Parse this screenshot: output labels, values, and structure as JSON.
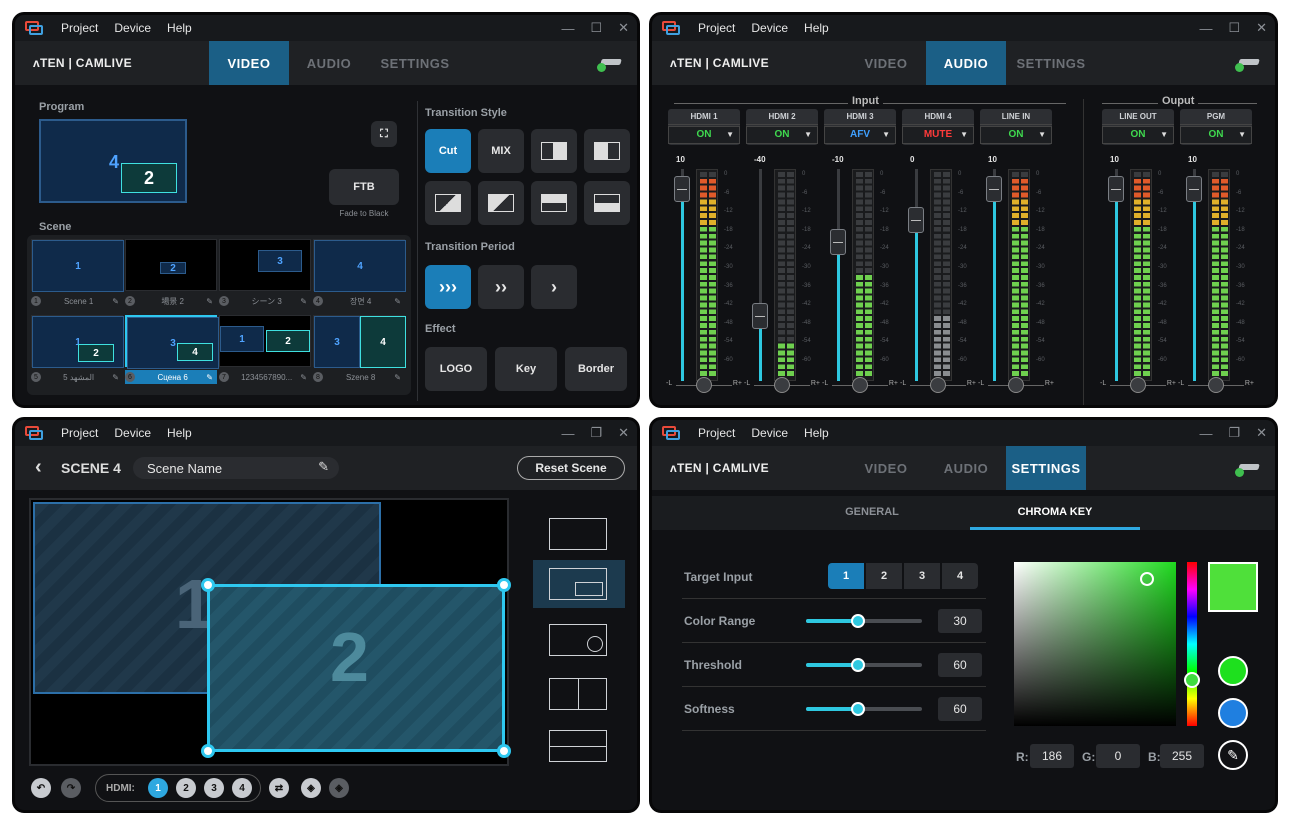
{
  "common": {
    "menu": [
      "Project",
      "Device",
      "Help"
    ],
    "brand": "ʌTEN | CAMLIVE",
    "tabs": [
      "VIDEO",
      "AUDIO",
      "SETTINGS"
    ]
  },
  "video": {
    "program_label": "Program",
    "program_boxes": [
      "4",
      "2"
    ],
    "ftb": "FTB",
    "ftb_sub": "Fade to Black",
    "scene_label": "Scene",
    "scenes": [
      {
        "num": "1",
        "name": "Scene 1",
        "boxes": [
          "1"
        ]
      },
      {
        "num": "2",
        "name": "場景 2",
        "boxes": [
          "2"
        ]
      },
      {
        "num": "3",
        "name": "シーン 3",
        "boxes": [
          "3"
        ]
      },
      {
        "num": "4",
        "name": "장면 4",
        "boxes": [
          "4"
        ]
      },
      {
        "num": "5",
        "name": "المشهد 5",
        "boxes": [
          "1",
          "2"
        ]
      },
      {
        "num": "6",
        "name": "Сцена 6",
        "boxes": [
          "3",
          "4"
        ]
      },
      {
        "num": "7",
        "name": "1234567890...",
        "boxes": [
          "1",
          "2"
        ]
      },
      {
        "num": "8",
        "name": "Szene 8",
        "boxes": [
          "3",
          "4"
        ]
      }
    ],
    "transition_style_label": "Transition Style",
    "transition_buttons": [
      "Cut",
      "MIX"
    ],
    "transition_period_label": "Transition Period",
    "effect_label": "Effect",
    "effects": [
      "LOGO",
      "Key",
      "Border"
    ]
  },
  "audio": {
    "input_label": "Input",
    "output_label": "Ouput",
    "channels": [
      {
        "name": "HDMI 1",
        "mode": "ON",
        "level": "10",
        "fader": 0.95,
        "meter": 0.95,
        "mode_color": "#3fd94f"
      },
      {
        "name": "HDMI 2",
        "mode": "ON",
        "level": "-40",
        "fader": 0.35,
        "meter": 0.15,
        "mode_color": "#3fd94f"
      },
      {
        "name": "HDMI 3",
        "mode": "AFV",
        "level": "-10",
        "fader": 0.7,
        "meter": 0.5,
        "mode_color": "#3fa0ff"
      },
      {
        "name": "HDMI 4",
        "mode": "MUTE",
        "level": "0",
        "fader": 0.8,
        "meter": 0.3,
        "mode_color": "#ff3b3b"
      },
      {
        "name": "LINE IN",
        "mode": "ON",
        "level": "10",
        "fader": 0.95,
        "meter": 0.95,
        "mode_color": "#3fd94f"
      },
      {
        "name": "LINE OUT",
        "mode": "ON",
        "level": "10",
        "fader": 0.95,
        "meter": 0.95,
        "mode_color": "#3fd94f"
      },
      {
        "name": "PGM",
        "mode": "ON",
        "level": "10",
        "fader": 0.95,
        "meter": 0.95,
        "mode_color": "#3fd94f"
      }
    ],
    "scale": [
      "0",
      "-6",
      "-12",
      "-18",
      "-24",
      "-30",
      "-36",
      "-42",
      "-48",
      "-54",
      "-60"
    ],
    "pan_l": "-L",
    "pan_r": "R+"
  },
  "scene_edit": {
    "title": "SCENE 4",
    "name_value": "Scene Name",
    "reset": "Reset Scene",
    "hdmi_label": "HDMI:",
    "hdmi": [
      "1",
      "2",
      "3",
      "4"
    ],
    "layer_labels": [
      "1",
      "2"
    ]
  },
  "settings": {
    "subtabs": [
      "GENERAL",
      "CHROMA KEY"
    ],
    "target_input_label": "Target Input",
    "target_inputs": [
      "1",
      "2",
      "3",
      "4"
    ],
    "color_range_label": "Color Range",
    "color_range": "30",
    "color_range_frac": 0.45,
    "threshold_label": "Threshold",
    "threshold": "60",
    "threshold_frac": 0.45,
    "softness_label": "Softness",
    "softness": "60",
    "softness_frac": 0.45,
    "r_label": "R:",
    "r": "186",
    "g_label": "G:",
    "g": "0",
    "b_label": "B:",
    "b": "255",
    "swatch_color": "#4fe03a",
    "preset_green": "#1ee01e",
    "preset_blue": "#1f7fe0"
  }
}
